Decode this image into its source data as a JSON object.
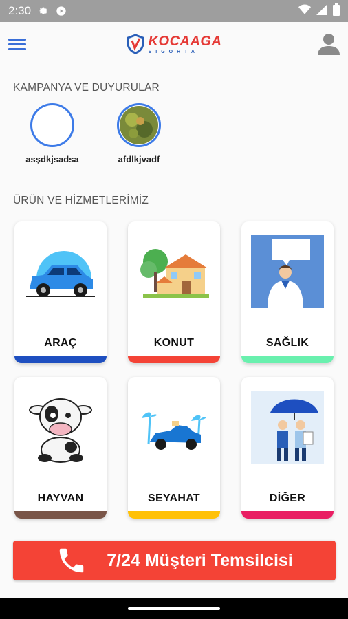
{
  "status": {
    "time": "2:30"
  },
  "header": {
    "logo_main": "KOCAAGA",
    "logo_sub": "SIGORTA"
  },
  "stories": {
    "title": "KAMPANYA VE DUYURULAR",
    "items": [
      {
        "label": "asşdkjsadsa"
      },
      {
        "label": "afdlkjvadf"
      }
    ]
  },
  "products": {
    "title": "ÜRÜN VE HİZMETLERİMİZ",
    "items": [
      {
        "label": "ARAÇ",
        "color": "#1e4fc0"
      },
      {
        "label": "KONUT",
        "color": "#f44336"
      },
      {
        "label": "SAĞLIK",
        "color": "#69f0ae"
      },
      {
        "label": "HAYVAN",
        "color": "#795548"
      },
      {
        "label": "SEYAHAT",
        "color": "#ffc107"
      },
      {
        "label": "DİĞER",
        "color": "#e91e63"
      }
    ]
  },
  "cta": {
    "label": "7/24 Müşteri Temsilcisi"
  }
}
